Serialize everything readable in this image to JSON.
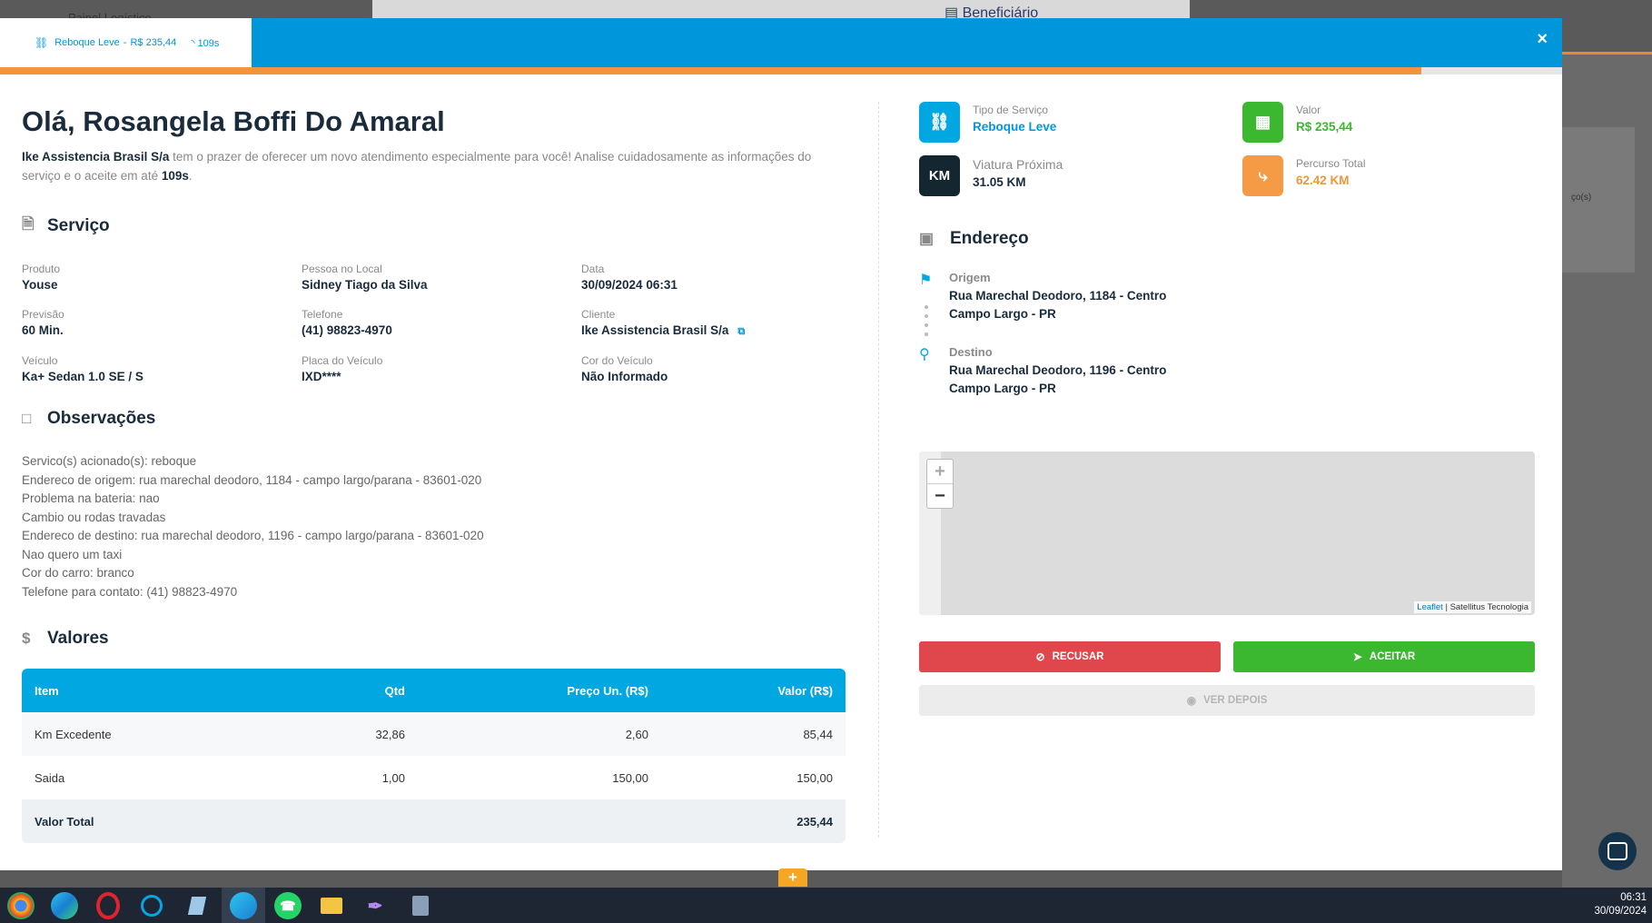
{
  "background": {
    "top_left_text": "Painel Logístico",
    "top_center_text": "Beneficiário",
    "right_partial_text": "ço(s)"
  },
  "header": {
    "tab_service": "Reboque Leve",
    "tab_price": "R$ 235,44",
    "tab_timer": "109s",
    "close_label": "×"
  },
  "progress": {
    "fraction": 0.91
  },
  "greeting": {
    "prefix": "Olá,",
    "name": "Rosangela Boffi Do Amaral",
    "company": "Ike Assistencia Brasil S/a",
    "message": "tem o prazer de oferecer um novo atendimento especialmente para você! Analise cuidadosamente as informações do serviço e o aceite em até",
    "seconds": "109s",
    "period": "."
  },
  "servico": {
    "title": "Serviço",
    "fields": [
      {
        "label": "Produto",
        "value": "Youse"
      },
      {
        "label": "Pessoa no Local",
        "value": "Sidney Tiago da Silva"
      },
      {
        "label": "Data",
        "value": "30/09/2024 06:31"
      },
      {
        "label": "Previsão",
        "value": "60 Min."
      },
      {
        "label": "Telefone",
        "value": "(41) 98823-4970"
      },
      {
        "label": "Cliente",
        "value": "Ike Assistencia Brasil S/a"
      },
      {
        "label": "Veículo",
        "value": "Ka+ Sedan 1.0 SE / S"
      },
      {
        "label": "Placa do Veículo",
        "value": "IXD****"
      },
      {
        "label": "Cor do Veículo",
        "value": "Não Informado"
      }
    ]
  },
  "observacoes": {
    "title": "Observações",
    "lines": [
      "Servico(s) acionado(s): reboque",
      "Endereco de origem: rua marechal deodoro, 1184 - campo largo/parana - 83601-020",
      "Problema na bateria: nao",
      "Cambio ou rodas travadas",
      "Endereco de destino: rua marechal deodoro, 1196 - campo largo/parana - 83601-020",
      "Nao quero um taxi",
      "Cor do carro: branco",
      "Telefone para contato: (41) 98823-4970"
    ]
  },
  "valores": {
    "title": "Valores",
    "headers": [
      "Item",
      "Qtd",
      "Preço Un. (R$)",
      "Valor (R$)"
    ],
    "rows": [
      [
        "Km Excedente",
        "32,86",
        "2,60",
        "85,44"
      ],
      [
        "Saida",
        "1,00",
        "150,00",
        "150,00"
      ]
    ],
    "total_label": "Valor Total",
    "total_value": "235,44"
  },
  "info_cards": {
    "tipo": {
      "label": "Tipo de Serviço",
      "value": "Reboque Leve"
    },
    "valor": {
      "label": "Valor",
      "value": "R$ 235,44"
    },
    "viatura": {
      "label": "Viatura Próxima",
      "value": "31.05 KM",
      "badge": "KM"
    },
    "percurso": {
      "label": "Percurso Total",
      "value": "62.42 KM"
    }
  },
  "endereco": {
    "title": "Endereço",
    "origem": {
      "label": "Origem",
      "line1": "Rua Marechal Deodoro, 1184 - Centro",
      "line2": "Campo Largo - PR"
    },
    "destino": {
      "label": "Destino",
      "line1": "Rua Marechal Deodoro, 1196 - Centro",
      "line2": "Campo Largo - PR"
    }
  },
  "map": {
    "zoom_in": "+",
    "zoom_out": "−",
    "attribution_link": "Leaflet",
    "attribution_sep": "|",
    "attribution_text": "Satellitus Tecnologia"
  },
  "actions": {
    "recusar": "RECUSAR",
    "aceitar": "ACEITAR",
    "ver_depois": "VER DEPOIS"
  },
  "fab_label": "+",
  "clock": {
    "time": "06:31",
    "date": "30/09/2024"
  },
  "colors": {
    "primary": "#0096db",
    "green": "#3cb830",
    "red": "#e0474c",
    "orange": "#f0963a",
    "dark": "#14262f"
  }
}
